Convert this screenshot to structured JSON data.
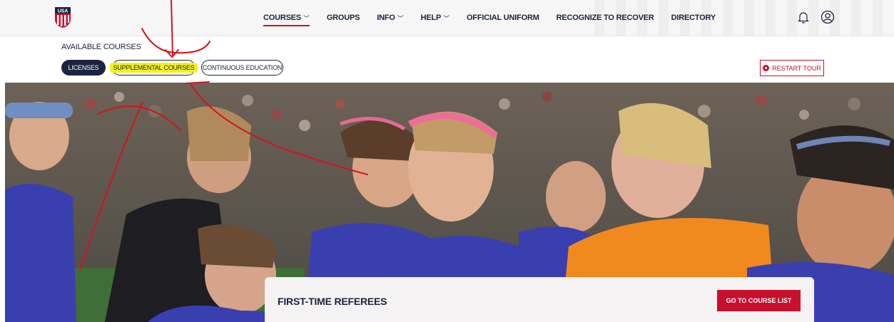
{
  "header": {
    "logo_text": "USA",
    "nav": [
      {
        "label": "COURSES",
        "chevron": true,
        "active": true
      },
      {
        "label": "GROUPS",
        "chevron": false
      },
      {
        "label": "INFO",
        "chevron": true
      },
      {
        "label": "HELP",
        "chevron": true
      },
      {
        "label": "OFFICIAL UNIFORM",
        "chevron": false
      },
      {
        "label": "RECOGNIZE TO RECOVER",
        "chevron": false
      },
      {
        "label": "DIRECTORY",
        "chevron": false
      }
    ],
    "icons": [
      "bell-icon",
      "user-icon"
    ]
  },
  "courses": {
    "title": "AVAILABLE COURSES",
    "tabs": [
      {
        "label": "LICENSES",
        "selected": true
      },
      {
        "label": "SUPPLEMENTAL COURSES",
        "highlighted": true
      },
      {
        "label": "CONTINUOUS EDUCATION"
      }
    ],
    "restart_label": "RESTART TOUR"
  },
  "hero": {
    "card_title": "FIRST-TIME REFEREES",
    "card_button": "GO TO COURSE LIST"
  },
  "colors": {
    "navy": "#1b2340",
    "red": "#c8102e",
    "highlight": "#f4f21d",
    "jersey": "#3a3fb0",
    "keeper": "#f08a1e"
  }
}
